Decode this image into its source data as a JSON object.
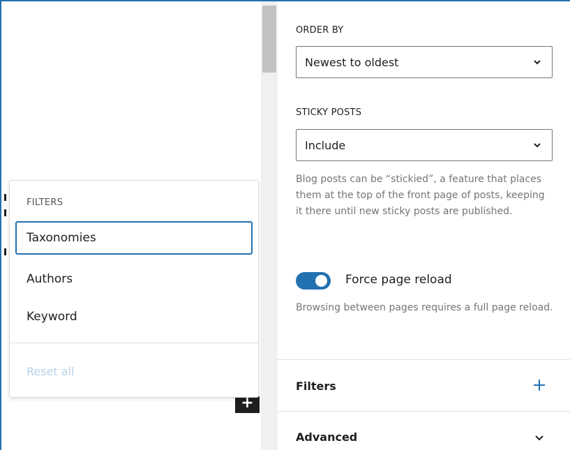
{
  "sidebar": {
    "order_by": {
      "label": "ORDER BY",
      "value": "Newest to oldest"
    },
    "sticky_posts": {
      "label": "STICKY POSTS",
      "value": "Include",
      "help": "Blog posts can be “stickied”, a feature that places them at the top of the front page of posts, keeping it there until new sticky posts are published."
    },
    "force_reload": {
      "label": "Force page reload",
      "checked": true,
      "help": "Browsing between pages requires a full page reload."
    },
    "panels": {
      "filters": {
        "title": "Filters",
        "icon": "plus-icon"
      },
      "advanced": {
        "title": "Advanced",
        "icon": "chevron-down-icon"
      }
    }
  },
  "filters_menu": {
    "heading": "FILTERS",
    "items": [
      {
        "label": "Taxonomies",
        "active": true
      },
      {
        "label": "Authors"
      },
      {
        "label": "Keyword"
      }
    ],
    "reset_label": "Reset all"
  },
  "canvas": {
    "add_block_icon": "plus-icon"
  },
  "colors": {
    "accent": "#2271b1",
    "text": "#1e1e1e",
    "muted": "#757575",
    "disabled": "#b7d1e6",
    "border": "#e0e0e0"
  }
}
